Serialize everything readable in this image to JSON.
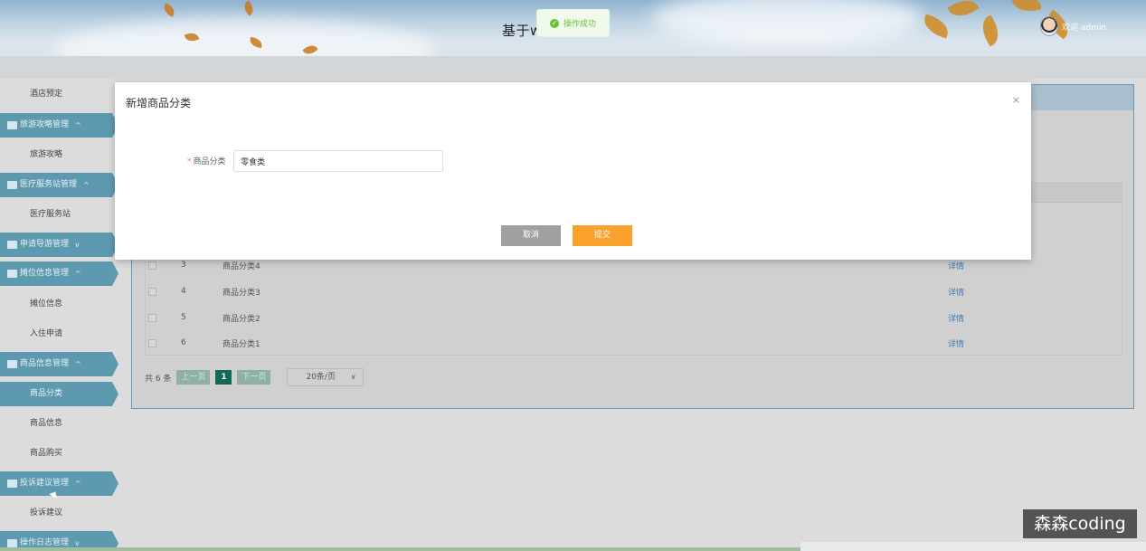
{
  "header": {
    "title": "基于w理系统",
    "user": "欢迎 admin"
  },
  "toast": {
    "text": "操作成功"
  },
  "sidebar": {
    "items": [
      {
        "type": "sub",
        "label": "酒店预定"
      },
      {
        "type": "head",
        "label": "旅游攻略管理",
        "chevron": "^",
        "icon": "building-icon"
      },
      {
        "type": "sub",
        "label": "旅游攻略"
      },
      {
        "type": "head",
        "label": "医疗服务站管理",
        "chevron": "^",
        "icon": "hospital-icon"
      },
      {
        "type": "sub",
        "label": "医疗服务站"
      },
      {
        "type": "head",
        "label": "申请导游管理",
        "chevron": "v",
        "icon": "guide-icon"
      },
      {
        "type": "head",
        "label": "摊位信息管理",
        "chevron": "^",
        "icon": "grid-icon"
      },
      {
        "type": "sub",
        "label": "摊位信息"
      },
      {
        "type": "sub",
        "label": "入住申请"
      },
      {
        "type": "head",
        "label": "商品信息管理",
        "chevron": "^",
        "icon": "cart-icon"
      },
      {
        "type": "active",
        "label": "商品分类"
      },
      {
        "type": "sub",
        "label": "商品信息"
      },
      {
        "type": "sub",
        "label": "商品购买"
      },
      {
        "type": "head",
        "label": "投诉建议管理",
        "chevron": "^",
        "icon": "comment-icon"
      },
      {
        "type": "sub",
        "label": "投诉建议"
      },
      {
        "type": "head",
        "label": "操作日志管理",
        "chevron": "v",
        "icon": "log-icon"
      }
    ]
  },
  "table": {
    "rows": [
      {
        "no": "3",
        "name": "商品分类4",
        "action": "详情"
      },
      {
        "no": "4",
        "name": "商品分类3",
        "action": "详情"
      },
      {
        "no": "5",
        "name": "商品分类2",
        "action": "详情"
      },
      {
        "no": "6",
        "name": "商品分类1",
        "action": "详情"
      }
    ]
  },
  "pager": {
    "total": "共 6 条",
    "prev": "上一页",
    "current": "1",
    "next": "下一页",
    "size": "20条/页"
  },
  "modal": {
    "title": "新增商品分类",
    "close": "×",
    "field_label": "商品分类",
    "required": "*",
    "field_value": "零食类",
    "cancel": "取消",
    "submit": "提交"
  },
  "watermark": "森森coding"
}
